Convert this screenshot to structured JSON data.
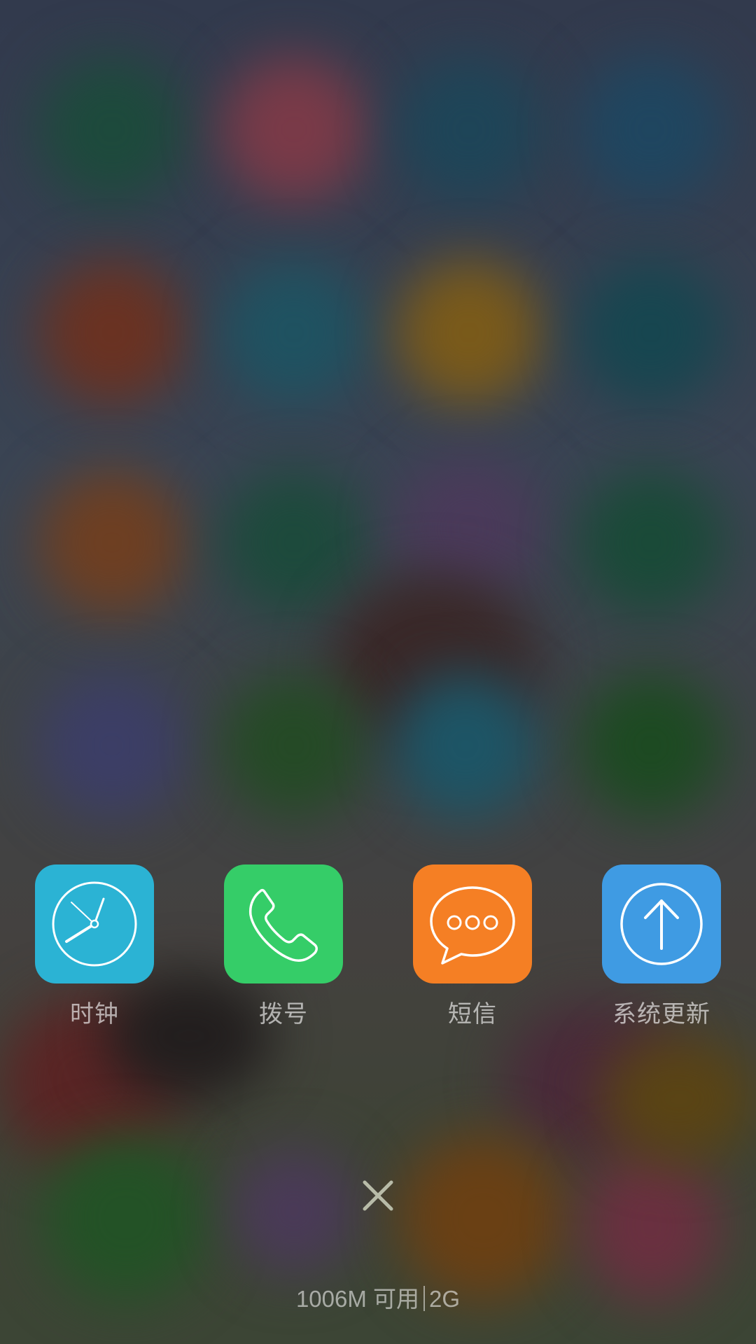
{
  "recent_apps": [
    {
      "label": "时钟",
      "icon": "clock-icon",
      "color": "#2bb3d4"
    },
    {
      "label": "拨号",
      "icon": "phone-icon",
      "color": "#35cd68"
    },
    {
      "label": "短信",
      "icon": "chat-bubble-icon",
      "color": "#f57f24"
    },
    {
      "label": "系统更新",
      "icon": "arrow-up-circle-icon",
      "color": "#3f9be3"
    }
  ],
  "close_button": {
    "icon": "close-icon"
  },
  "memory": {
    "available": "1006M 可用",
    "total": "2G"
  }
}
